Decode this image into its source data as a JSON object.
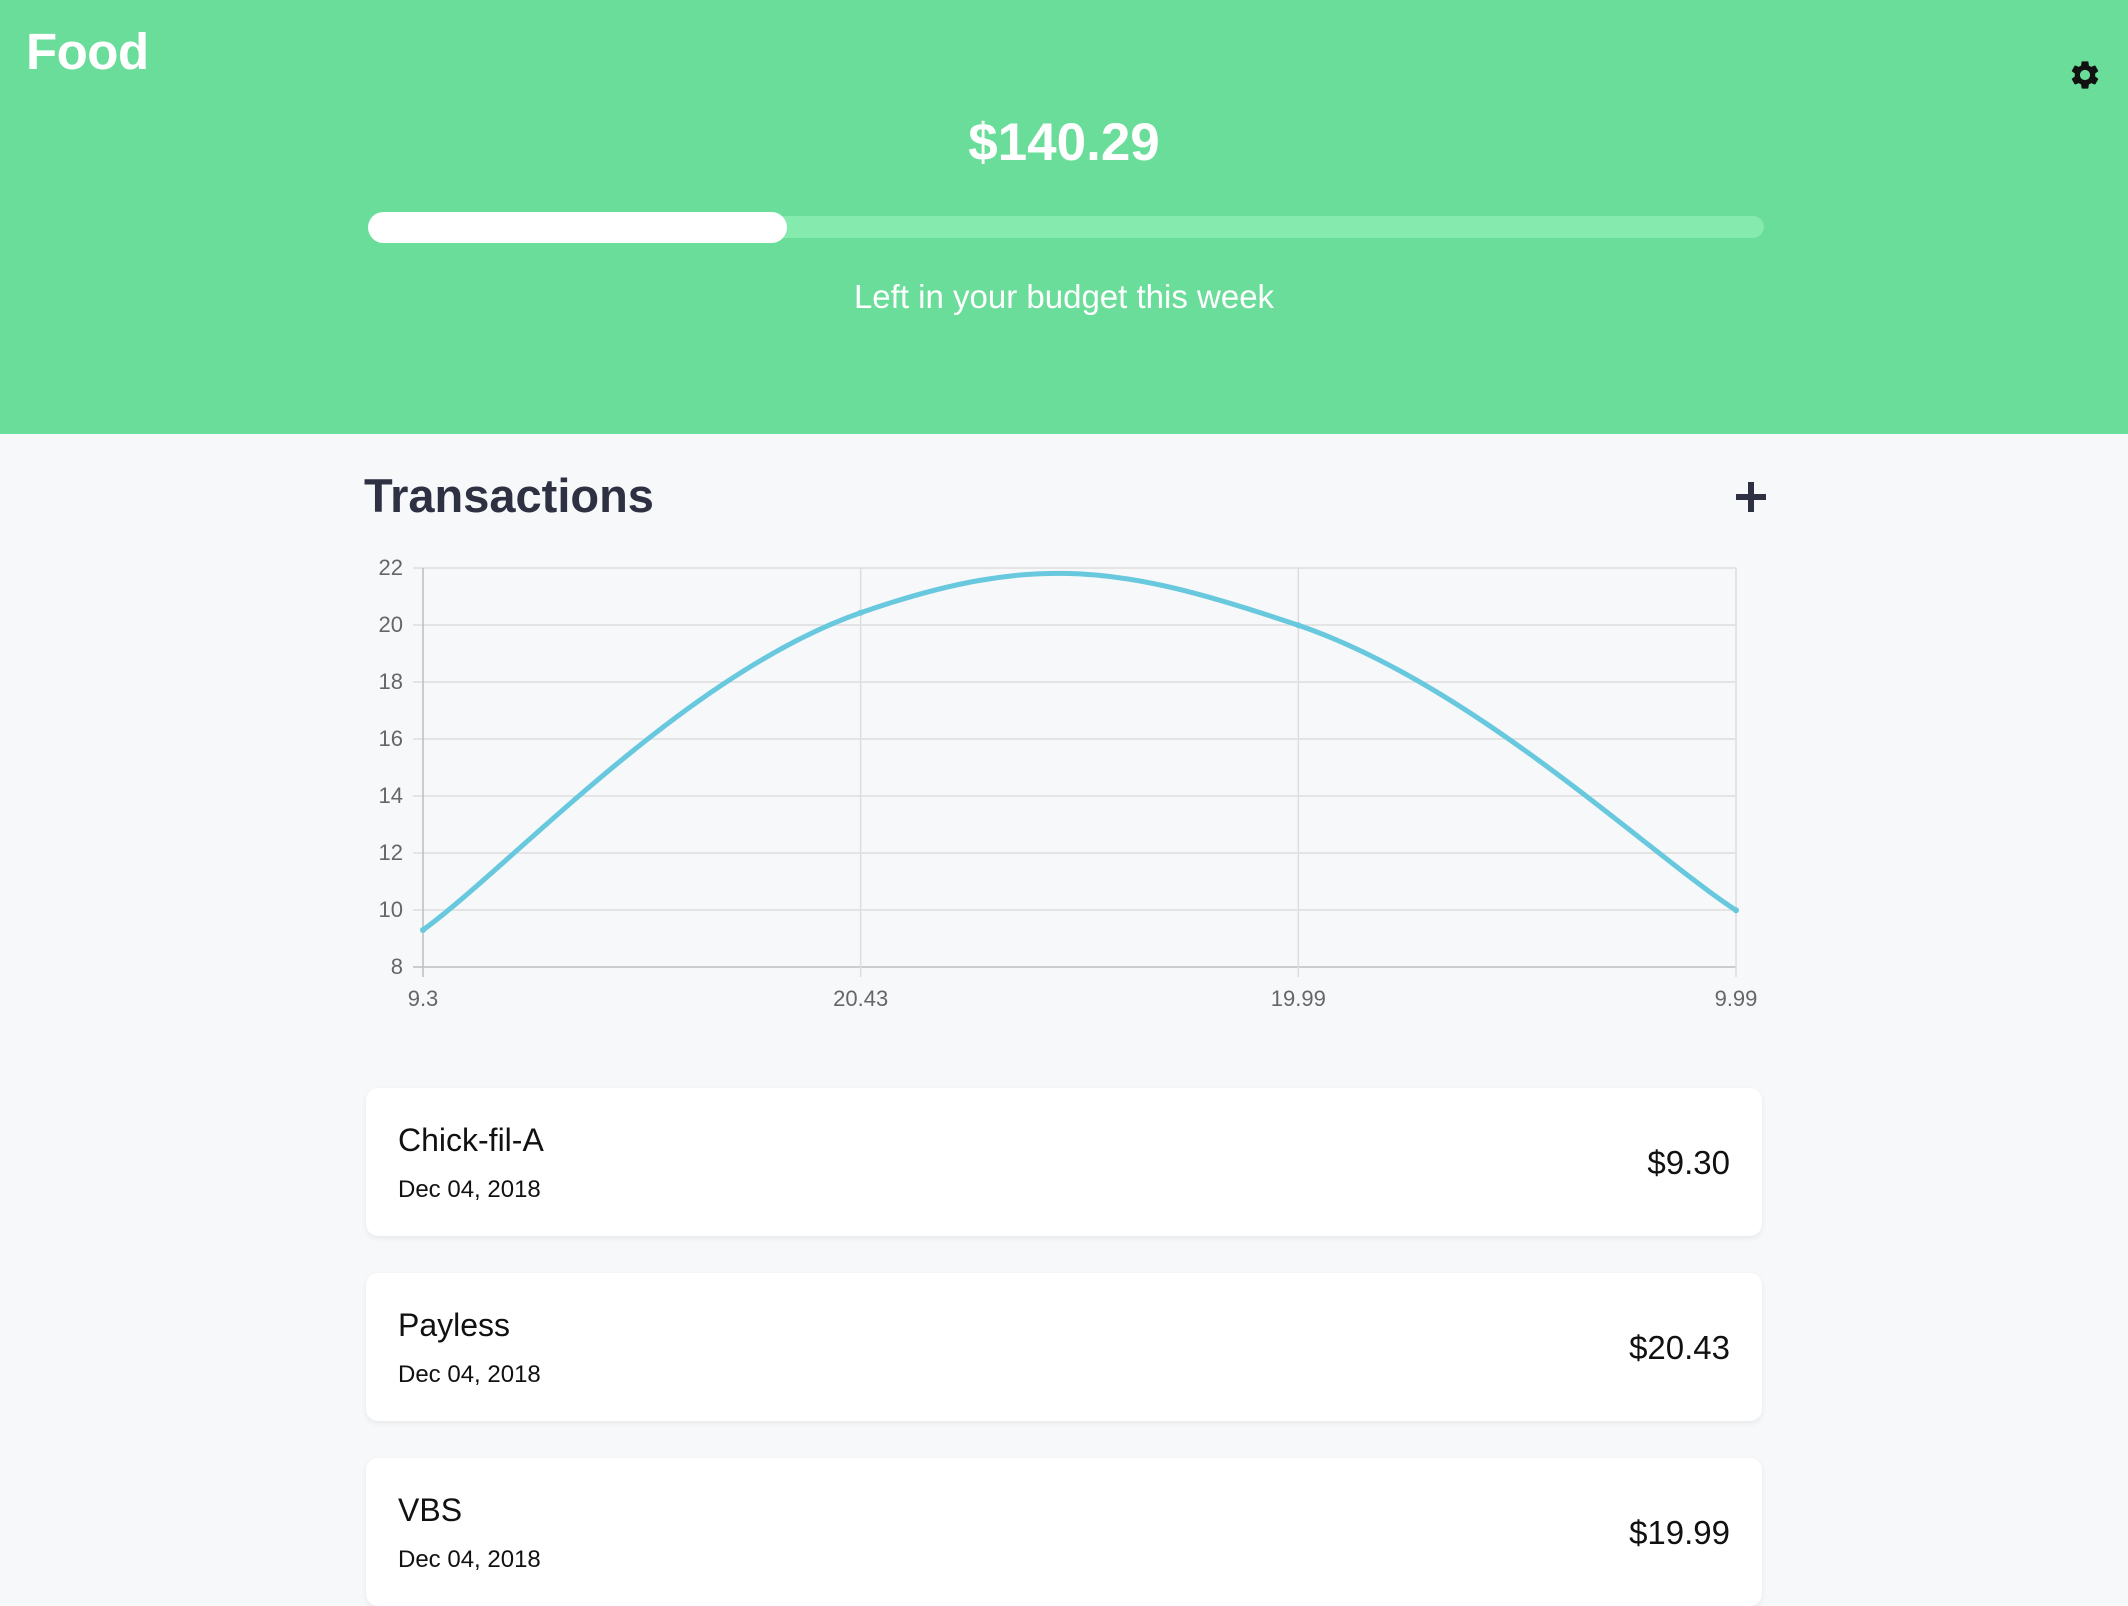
{
  "header": {
    "title": "Food",
    "amount": "$140.29",
    "caption": "Left in your budget this week",
    "progress_fraction": 0.3,
    "background_color": "#69dd99",
    "settings_icon": "gear-icon"
  },
  "transactions": {
    "title": "Transactions",
    "add_icon": "plus-icon",
    "items": [
      {
        "name": "Chick-fil-A",
        "date": "Dec 04, 2018",
        "amount": "$9.30"
      },
      {
        "name": "Payless",
        "date": "Dec 04, 2018",
        "amount": "$20.43"
      },
      {
        "name": "VBS",
        "date": "Dec 04, 2018",
        "amount": "$19.99"
      }
    ]
  },
  "chart_data": {
    "type": "line",
    "categories": [
      "9.3",
      "20.43",
      "19.99",
      "9.99"
    ],
    "values": [
      9.3,
      20.43,
      19.99,
      9.99
    ],
    "ylim": [
      8,
      22
    ],
    "y_ticks": [
      8,
      10,
      12,
      14,
      16,
      18,
      20,
      22
    ],
    "grid": true,
    "line_color": "#68c8de"
  }
}
